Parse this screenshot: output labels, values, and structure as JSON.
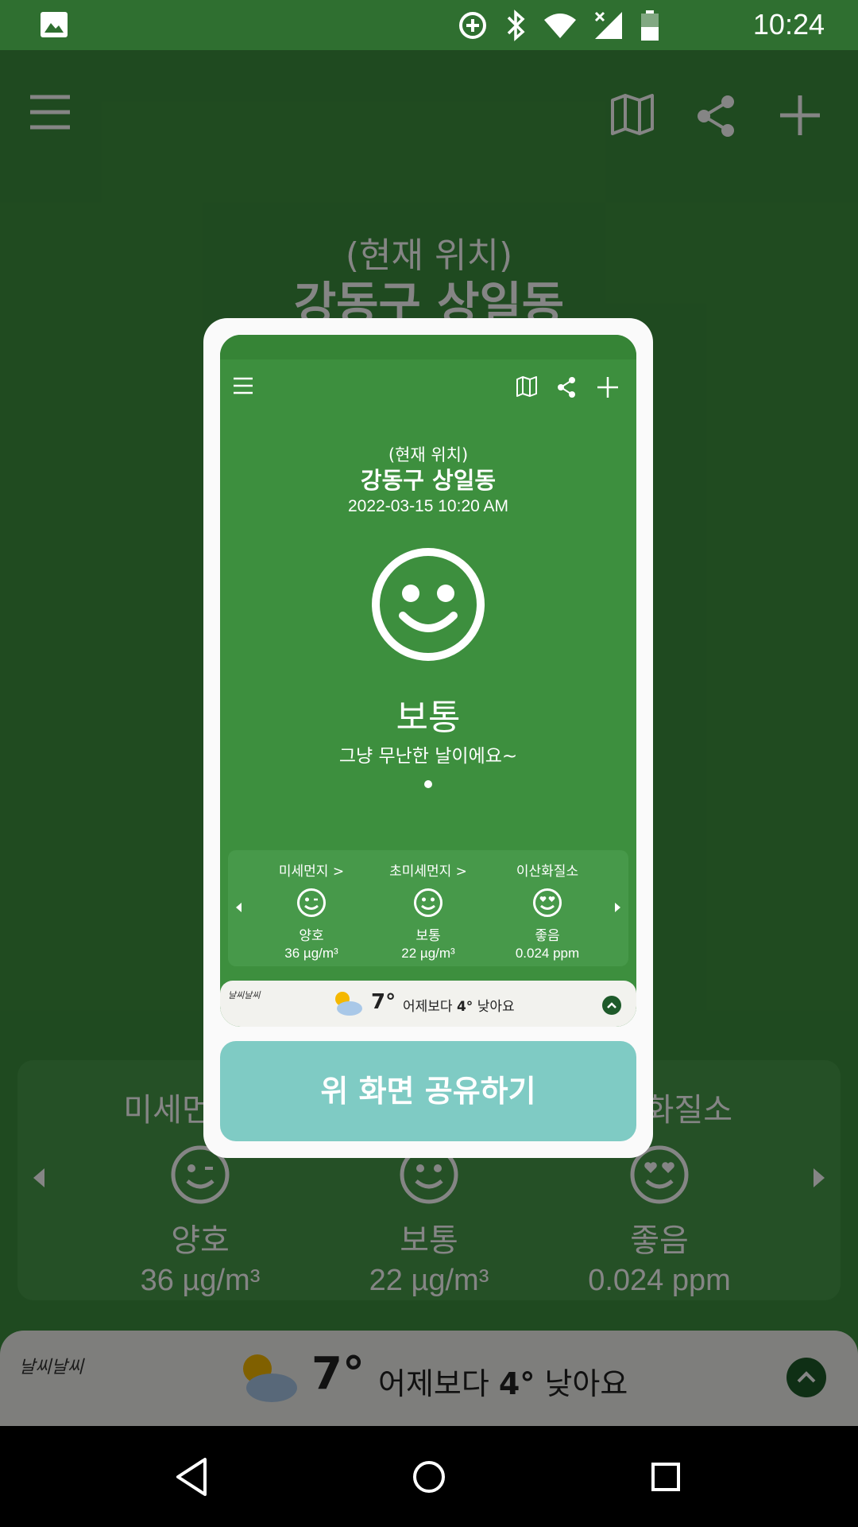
{
  "status_bar": {
    "time": "10:24",
    "icons": [
      "gallery-icon",
      "data-saver-icon",
      "bluetooth-icon",
      "wifi-icon",
      "signal-off-icon",
      "battery-icon"
    ]
  },
  "app": {
    "location_prefix": "(현재 위치)",
    "location": "강동구 상일동",
    "card": {
      "items": [
        {
          "title": "미세먼지 >",
          "status": "양호",
          "value": "36 µg/m³",
          "face": "winking-face-icon"
        },
        {
          "title": "초미세먼지 >",
          "status": "보통",
          "value": "22 µg/m³",
          "face": "smiling-face-icon"
        },
        {
          "title": "이산화질소",
          "status": "좋음",
          "value": "0.024 ppm",
          "face": "heart-eyes-face-icon"
        }
      ]
    },
    "weather": {
      "brand": "날씨날씨",
      "temp": "7°",
      "desc_prefix": "어제보다 ",
      "desc_bold": "4°",
      "desc_suffix": " 낮아요"
    }
  },
  "dialog": {
    "preview": {
      "location_prefix": "(현재 위치)",
      "location": "강동구 상일동",
      "datetime": "2022-03-15 10:20 AM",
      "grade": "보통",
      "message": "그냥 무난한 날이에요~"
    },
    "share_button_label": "위 화면 공유하기"
  },
  "colors": {
    "primary_green": "#3d8f3e",
    "card_green": "#47994a",
    "share_button": "#7fcbc4",
    "weather_bar": "#f2f2ee",
    "expand_dark": "#1e5a2a"
  }
}
